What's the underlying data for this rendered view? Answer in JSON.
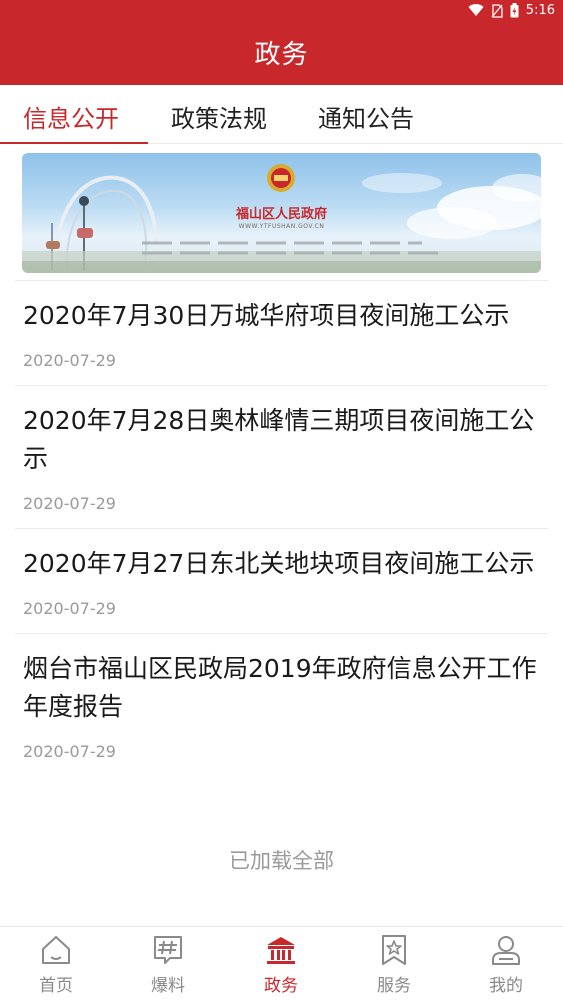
{
  "status_bar": {
    "time": "5:16"
  },
  "header": {
    "title": "政务"
  },
  "tabs": [
    {
      "label": "信息公开",
      "active": true
    },
    {
      "label": "政策法规",
      "active": false
    },
    {
      "label": "通知公告",
      "active": false
    }
  ],
  "banner": {
    "title": "福山区人民政府",
    "url": "WWW.YTFUSHAN.GOV.CN"
  },
  "articles": [
    {
      "title": "2020年7月30日万城华府项目夜间施工公示",
      "date": "2020-07-29"
    },
    {
      "title": "2020年7月28日奥林峰情三期项目夜间施工公示",
      "date": "2020-07-29"
    },
    {
      "title": "2020年7月27日东北关地块项目夜间施工公示",
      "date": "2020-07-29"
    },
    {
      "title": "烟台市福山区民政局2019年政府信息公开工作年度报告",
      "date": "2020-07-29"
    }
  ],
  "list_footer": "已加载全部",
  "bottom_nav": [
    {
      "label": "首页",
      "icon": "home-icon",
      "active": false
    },
    {
      "label": "爆料",
      "icon": "hashtag-chat-icon",
      "active": false
    },
    {
      "label": "政务",
      "icon": "government-building-icon",
      "active": true
    },
    {
      "label": "服务",
      "icon": "star-bookmark-icon",
      "active": false
    },
    {
      "label": "我的",
      "icon": "user-icon",
      "active": false
    }
  ],
  "colors": {
    "brand_red": "#c8282c",
    "muted_text": "#9a9a9a",
    "nav_inactive": "#8a8a8a"
  }
}
